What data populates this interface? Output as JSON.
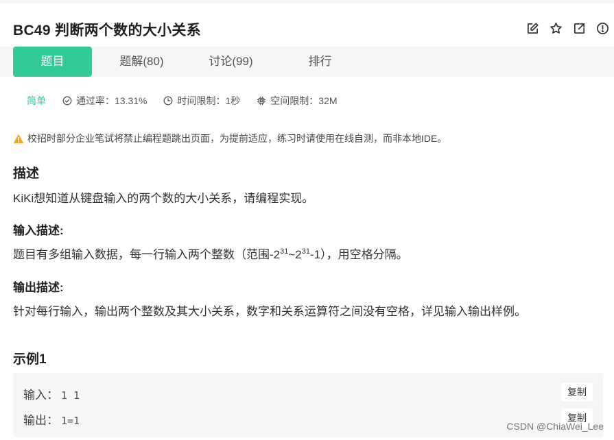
{
  "problem": {
    "title": "BC49  判断两个数的大小关系"
  },
  "header_actions": [
    {
      "name": "edit-icon"
    },
    {
      "name": "star-icon"
    },
    {
      "name": "share-icon"
    },
    {
      "name": "report-icon"
    }
  ],
  "tabs": [
    {
      "label": "题目",
      "active": true
    },
    {
      "label": "题解(80)",
      "active": false
    },
    {
      "label": "讨论(99)",
      "active": false
    },
    {
      "label": "排行",
      "active": false
    }
  ],
  "meta": {
    "difficulty": "简单",
    "pass_rate": "通过率：13.31%",
    "time_limit": "时间限制：1秒",
    "space_limit": "空间限制：32M"
  },
  "notice": "校招时部分企业笔试将禁止编程题跳出页面，为提前适应，练习时请使用在线自测，而非本地IDE。",
  "description": {
    "heading": "描述",
    "text": "KiKi想知道从键盘输入的两个数的大小关系，请编程实现。"
  },
  "input_desc": {
    "heading": "输入描述:",
    "text_before": "题目有多组输入数据，每一行输入两个整数（范围-2",
    "exp1": "31",
    "text_mid": "~2",
    "exp2": "31",
    "text_after": "-1），用空格分隔。"
  },
  "output_desc": {
    "heading": "输出描述:",
    "text": "针对每行输入，输出两个整数及其大小关系，数字和关系运算符之间没有空格，详见输入输出样例。"
  },
  "example": {
    "heading": "示例1",
    "input_label": "输入：",
    "input_value": "1 1",
    "output_label": "输出：",
    "output_value": "1=1",
    "copy_label": "复制"
  },
  "watermark": "CSDN @ChiaWei_Lee",
  "colors": {
    "accent": "#32ca99",
    "warning": "#f5a623",
    "tab_bg": "#f5f6f8"
  }
}
